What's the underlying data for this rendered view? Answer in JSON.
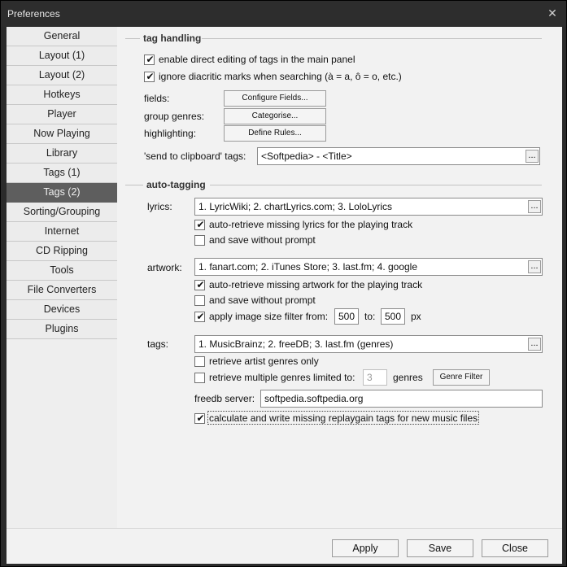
{
  "window": {
    "title": "Preferences",
    "close_glyph": "✕"
  },
  "sidebar": {
    "items": [
      {
        "label": "General"
      },
      {
        "label": "Layout (1)"
      },
      {
        "label": "Layout (2)"
      },
      {
        "label": "Hotkeys"
      },
      {
        "label": "Player"
      },
      {
        "label": "Now Playing"
      },
      {
        "label": "Library"
      },
      {
        "label": "Tags (1)"
      },
      {
        "label": "Tags (2)"
      },
      {
        "label": "Sorting/Grouping"
      },
      {
        "label": "Internet"
      },
      {
        "label": "CD Ripping"
      },
      {
        "label": "Tools"
      },
      {
        "label": "File Converters"
      },
      {
        "label": "Devices"
      },
      {
        "label": "Plugins"
      }
    ],
    "active": "Tags (2)"
  },
  "tag_handling": {
    "title": "tag handling",
    "direct_edit": {
      "label": "enable direct editing of tags in the main panel",
      "checked": true
    },
    "ignore_diacritic": {
      "label": "ignore diacritic marks when searching (à = a, ô = o, etc.)",
      "checked": true
    },
    "fields": {
      "label": "fields:",
      "button": "Configure Fields..."
    },
    "group_genres": {
      "label": "group genres:",
      "button": "Categorise..."
    },
    "highlighting": {
      "label": "highlighting:",
      "button": "Define Rules..."
    },
    "send_clipboard": {
      "label": "'send to clipboard' tags:",
      "value": "<Softpedia> - <Title>",
      "ellipsis": "..."
    }
  },
  "auto_tagging": {
    "title": "auto-tagging",
    "lyrics": {
      "label": "lyrics:",
      "value": "1. LyricWiki; 2. chartLyrics.com; 3. LoloLyrics",
      "ellipsis": "...",
      "auto_retrieve": {
        "label": "auto-retrieve missing lyrics for the playing track",
        "checked": true
      },
      "save_no_prompt": {
        "label": "and save without prompt",
        "checked": false
      }
    },
    "artwork": {
      "label": "artwork:",
      "value": "1. fanart.com; 2. iTunes Store; 3. last.fm; 4. google",
      "ellipsis": "...",
      "auto_retrieve": {
        "label": "auto-retrieve missing artwork for the playing track",
        "checked": true
      },
      "save_no_prompt": {
        "label": "and save without prompt",
        "checked": false
      },
      "size_filter": {
        "label": "apply image size filter from:",
        "checked": true,
        "from": "500",
        "to_label": "to:",
        "to": "500",
        "unit": "px"
      }
    },
    "tags": {
      "label": "tags:",
      "value": "1. MusicBrainz; 2. freeDB; 3. last.fm (genres)",
      "ellipsis": "...",
      "artist_genres": {
        "label": "retrieve artist genres only",
        "checked": false
      },
      "multiple_genres": {
        "label": "retrieve multiple genres limited to:",
        "checked": false,
        "value": "3",
        "suffix": "genres",
        "button": "Genre Filter"
      },
      "freedb": {
        "label": "freedb server:",
        "value": "softpedia.softpedia.org"
      },
      "replaygain": {
        "label": "calculate and write missing replaygain tags for new music files",
        "checked": true
      }
    }
  },
  "footer": {
    "apply": "Apply",
    "save": "Save",
    "close": "Close"
  },
  "check_glyph": "✔"
}
